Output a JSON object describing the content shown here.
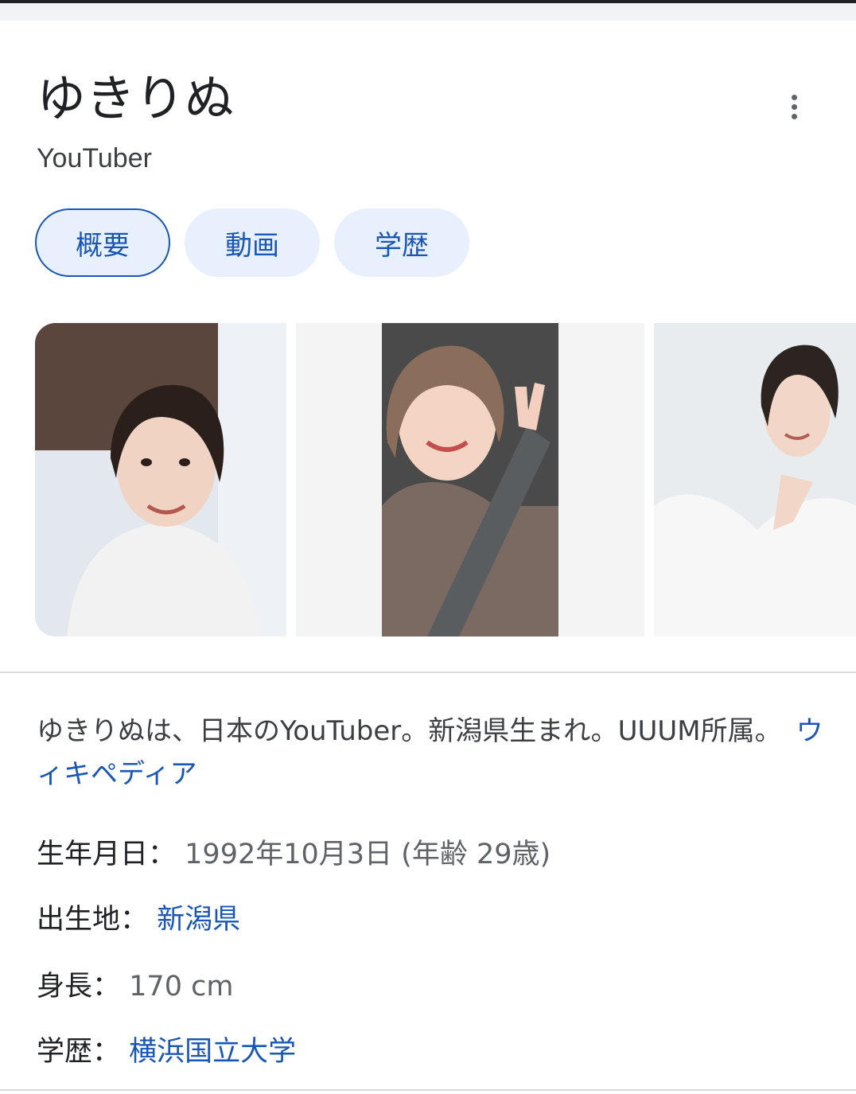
{
  "title": "ゆきりぬ",
  "subtitle": "YouTuber",
  "chips": [
    {
      "label": "概要",
      "active": true
    },
    {
      "label": "動画",
      "active": false
    },
    {
      "label": "学歴",
      "active": false
    }
  ],
  "images": [
    {
      "name": "photo-1"
    },
    {
      "name": "photo-2"
    },
    {
      "name": "photo-3"
    }
  ],
  "description": {
    "text": "ゆきりぬは、日本のYouTuber。新潟県生まれ。UUUM所属。",
    "link": "ウィキペディア"
  },
  "facts": [
    {
      "label": "生年月日：",
      "value": "1992年10月3日 (年齢 29歳)",
      "link": false
    },
    {
      "label": "出生地：",
      "value": "新潟県",
      "link": true
    },
    {
      "label": "身長：",
      "value": "170 cm",
      "link": false
    },
    {
      "label": "学歴：",
      "value": "横浜国立大学",
      "link": true
    }
  ],
  "colors": {
    "link": "#1a56b4",
    "chip_bg": "#e8f0fe",
    "text": "#202124",
    "secondary": "#5f6368"
  },
  "icons": {
    "menu": "more-vert-icon"
  }
}
